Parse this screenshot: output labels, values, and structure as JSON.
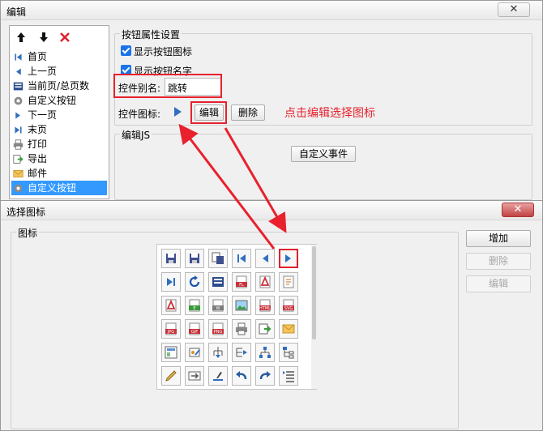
{
  "edit_window": {
    "title": "编辑",
    "close_glyph": "✕",
    "toolbar": {
      "up_icon": "up-arrow-icon",
      "down_icon": "down-arrow-icon",
      "delete_icon": "red-x-icon"
    },
    "list_items": [
      {
        "label": "首页",
        "icon": "first-page-icon"
      },
      {
        "label": "上一页",
        "icon": "previous-page-icon"
      },
      {
        "label": "当前页/总页数",
        "icon": "page-count-icon"
      },
      {
        "label": "自定义按钮",
        "icon": "gear-icon"
      },
      {
        "label": "下一页",
        "icon": "next-page-icon"
      },
      {
        "label": "末页",
        "icon": "last-page-icon"
      },
      {
        "label": "打印",
        "icon": "printer-icon"
      },
      {
        "label": "导出",
        "icon": "export-icon"
      },
      {
        "label": "邮件",
        "icon": "mail-icon"
      },
      {
        "label": "自定义按钮",
        "icon": "gear-icon",
        "selected": true
      }
    ],
    "props": {
      "group_title": "按钮属性设置",
      "show_icon_label": "显示按钮图标",
      "show_icon_checked": true,
      "show_name_label": "显示按钮名字",
      "show_name_checked": true,
      "alias_label": "控件别名:",
      "alias_value": "跳转",
      "icon_label": "控件图标:",
      "edit_button": "编辑",
      "delete_button": "删除",
      "annotation": "点击编辑选择图标"
    },
    "js_group": {
      "title": "编辑JS",
      "custom_event_button": "自定义事件"
    }
  },
  "icon_window": {
    "title": "选择图标",
    "close_glyph": "✕",
    "group_title": "图标",
    "add_button": "增加",
    "delete_button": "删除",
    "edit_button": "编辑",
    "icons": [
      [
        "save-icon",
        "save-as-icon",
        "save-copy-icon",
        "first-page-icon",
        "previous-page-icon",
        "next-page-icon"
      ],
      [
        "last-page-icon",
        "refresh-icon",
        "page-count-icon",
        "pdf-flash-icon",
        "pdf-print-icon",
        "applet-print-icon"
      ],
      [
        "pdf-icon",
        "excel-icon",
        "word-icon",
        "image-icon",
        "html-icon",
        "svg-icon"
      ],
      [
        "jpg-icon",
        "gif-icon",
        "png-icon",
        "printer-icon",
        "export-icon",
        "mail-icon"
      ],
      [
        "form-icon",
        "edit-cells-icon",
        "tree-down-icon",
        "tree-right-icon",
        "tree-icon",
        "tree-list-icon"
      ],
      [
        "pencil-icon",
        "submit-icon",
        "brush-icon",
        "undo-icon",
        "redo-icon",
        "list-indent-icon"
      ]
    ],
    "selected_icon": "next-page-icon"
  },
  "colors": {
    "accent_red": "#e8212d",
    "selection_blue": "#3399ff",
    "icon_blue": "#2f6fc0"
  }
}
